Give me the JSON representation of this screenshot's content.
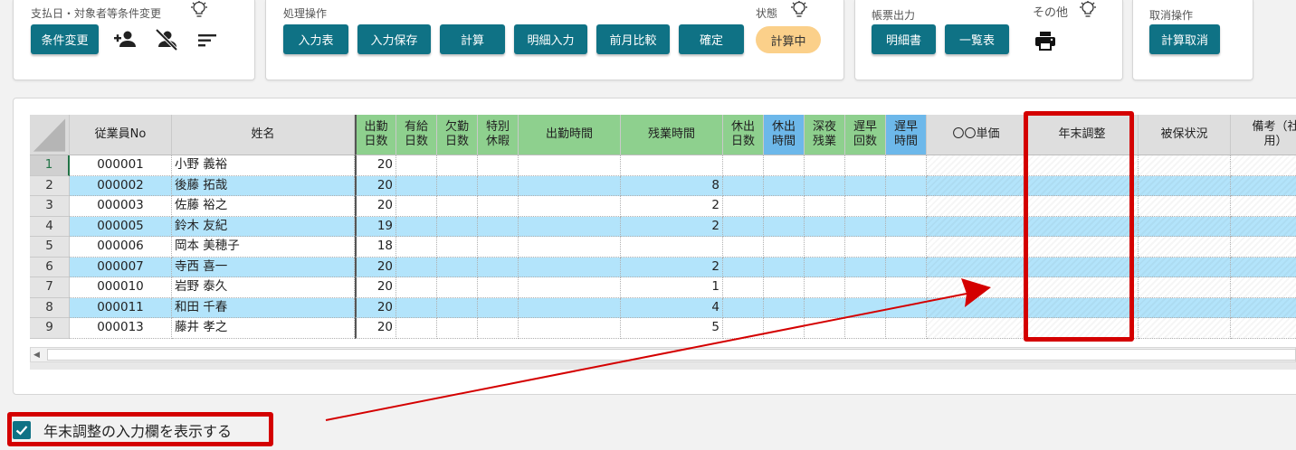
{
  "panels": {
    "conditions": {
      "title": "支払日・対象者等条件変更",
      "change_button": "条件変更",
      "icons": [
        "person-add-icon",
        "person-off-icon",
        "filter-list-icon",
        "lightbulb-icon"
      ]
    },
    "operations": {
      "title": "処理操作",
      "buttons": [
        "入力表",
        "入力保存",
        "計算",
        "明細入力",
        "前月比較",
        "確定"
      ],
      "status_title": "状態",
      "status_value": "計算中"
    },
    "reports": {
      "title": "帳票出力",
      "buttons": [
        "明細書",
        "一覧表"
      ],
      "other_title": "その他",
      "icons": [
        "print-icon",
        "lightbulb-icon"
      ]
    },
    "cancel": {
      "title": "取消操作",
      "button": "計算取消"
    }
  },
  "grid": {
    "columns": [
      {
        "label": "従業員No",
        "color": "gray"
      },
      {
        "label": "姓名",
        "color": "gray"
      },
      {
        "label": "出勤\n日数",
        "color": "green"
      },
      {
        "label": "有給\n日数",
        "color": "green"
      },
      {
        "label": "欠勤\n日数",
        "color": "green"
      },
      {
        "label": "特別\n休暇",
        "color": "green"
      },
      {
        "label": "出勤時間",
        "color": "green"
      },
      {
        "label": "残業時間",
        "color": "green"
      },
      {
        "label": "休出\n日数",
        "color": "green"
      },
      {
        "label": "休出\n時間",
        "color": "blue"
      },
      {
        "label": "深夜\n残業",
        "color": "green"
      },
      {
        "label": "遅早\n回数",
        "color": "green"
      },
      {
        "label": "遅早\n時間",
        "color": "blue"
      },
      {
        "label": "〇〇単価",
        "color": "gray"
      },
      {
        "label": "年末調整",
        "color": "gray"
      },
      {
        "label": "被保状況",
        "color": "gray"
      },
      {
        "label": "備考（社\n用）",
        "color": "gray"
      }
    ],
    "rows": [
      {
        "num": "1",
        "emp_no": "000001",
        "name": "小野 義裕",
        "work_days": "20",
        "overtime": ""
      },
      {
        "num": "2",
        "emp_no": "000002",
        "name": "後藤 拓哉",
        "work_days": "20",
        "overtime": "8"
      },
      {
        "num": "3",
        "emp_no": "000003",
        "name": "佐藤 裕之",
        "work_days": "20",
        "overtime": "2"
      },
      {
        "num": "4",
        "emp_no": "000005",
        "name": "鈴木 友紀",
        "work_days": "19",
        "overtime": "2"
      },
      {
        "num": "5",
        "emp_no": "000006",
        "name": "岡本 美穂子",
        "work_days": "18",
        "overtime": ""
      },
      {
        "num": "6",
        "emp_no": "000007",
        "name": "寺西 喜一",
        "work_days": "20",
        "overtime": "2"
      },
      {
        "num": "7",
        "emp_no": "000010",
        "name": "岩野 泰久",
        "work_days": "20",
        "overtime": "1"
      },
      {
        "num": "8",
        "emp_no": "000011",
        "name": "和田 千春",
        "work_days": "20",
        "overtime": "4"
      },
      {
        "num": "9",
        "emp_no": "000013",
        "name": "藤井 孝之",
        "work_days": "20",
        "overtime": "5"
      }
    ]
  },
  "checkbox": {
    "label": "年末調整の入力欄を表示する",
    "checked": true
  },
  "colors": {
    "button": "#0f7285",
    "status_badge": "#fbd08a",
    "header_green": "#8ed08e",
    "header_blue": "#6db8ea",
    "header_gray": "#dedede",
    "row_blue": "#b3e4fb",
    "highlight": "#d40000"
  }
}
